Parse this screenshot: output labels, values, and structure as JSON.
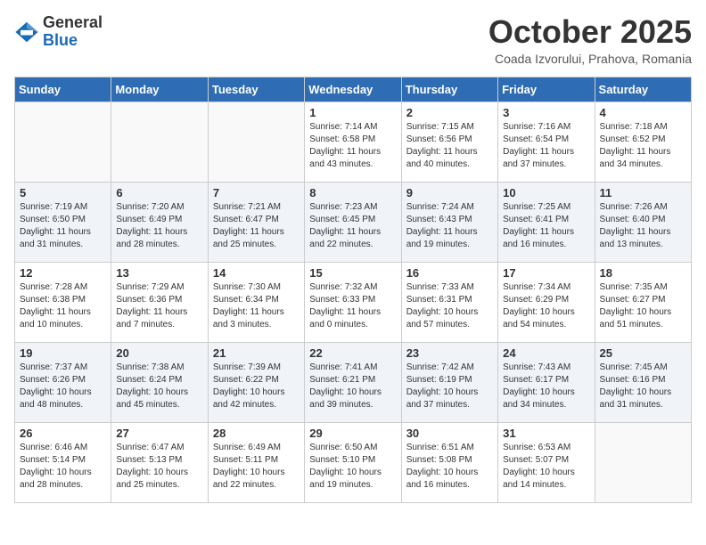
{
  "logo": {
    "general": "General",
    "blue": "Blue"
  },
  "title": "October 2025",
  "location": "Coada Izvorului, Prahova, Romania",
  "days_of_week": [
    "Sunday",
    "Monday",
    "Tuesday",
    "Wednesday",
    "Thursday",
    "Friday",
    "Saturday"
  ],
  "weeks": [
    [
      {
        "day": "",
        "info": ""
      },
      {
        "day": "",
        "info": ""
      },
      {
        "day": "",
        "info": ""
      },
      {
        "day": "1",
        "info": "Sunrise: 7:14 AM\nSunset: 6:58 PM\nDaylight: 11 hours and 43 minutes."
      },
      {
        "day": "2",
        "info": "Sunrise: 7:15 AM\nSunset: 6:56 PM\nDaylight: 11 hours and 40 minutes."
      },
      {
        "day": "3",
        "info": "Sunrise: 7:16 AM\nSunset: 6:54 PM\nDaylight: 11 hours and 37 minutes."
      },
      {
        "day": "4",
        "info": "Sunrise: 7:18 AM\nSunset: 6:52 PM\nDaylight: 11 hours and 34 minutes."
      }
    ],
    [
      {
        "day": "5",
        "info": "Sunrise: 7:19 AM\nSunset: 6:50 PM\nDaylight: 11 hours and 31 minutes."
      },
      {
        "day": "6",
        "info": "Sunrise: 7:20 AM\nSunset: 6:49 PM\nDaylight: 11 hours and 28 minutes."
      },
      {
        "day": "7",
        "info": "Sunrise: 7:21 AM\nSunset: 6:47 PM\nDaylight: 11 hours and 25 minutes."
      },
      {
        "day": "8",
        "info": "Sunrise: 7:23 AM\nSunset: 6:45 PM\nDaylight: 11 hours and 22 minutes."
      },
      {
        "day": "9",
        "info": "Sunrise: 7:24 AM\nSunset: 6:43 PM\nDaylight: 11 hours and 19 minutes."
      },
      {
        "day": "10",
        "info": "Sunrise: 7:25 AM\nSunset: 6:41 PM\nDaylight: 11 hours and 16 minutes."
      },
      {
        "day": "11",
        "info": "Sunrise: 7:26 AM\nSunset: 6:40 PM\nDaylight: 11 hours and 13 minutes."
      }
    ],
    [
      {
        "day": "12",
        "info": "Sunrise: 7:28 AM\nSunset: 6:38 PM\nDaylight: 11 hours and 10 minutes."
      },
      {
        "day": "13",
        "info": "Sunrise: 7:29 AM\nSunset: 6:36 PM\nDaylight: 11 hours and 7 minutes."
      },
      {
        "day": "14",
        "info": "Sunrise: 7:30 AM\nSunset: 6:34 PM\nDaylight: 11 hours and 3 minutes."
      },
      {
        "day": "15",
        "info": "Sunrise: 7:32 AM\nSunset: 6:33 PM\nDaylight: 11 hours and 0 minutes."
      },
      {
        "day": "16",
        "info": "Sunrise: 7:33 AM\nSunset: 6:31 PM\nDaylight: 10 hours and 57 minutes."
      },
      {
        "day": "17",
        "info": "Sunrise: 7:34 AM\nSunset: 6:29 PM\nDaylight: 10 hours and 54 minutes."
      },
      {
        "day": "18",
        "info": "Sunrise: 7:35 AM\nSunset: 6:27 PM\nDaylight: 10 hours and 51 minutes."
      }
    ],
    [
      {
        "day": "19",
        "info": "Sunrise: 7:37 AM\nSunset: 6:26 PM\nDaylight: 10 hours and 48 minutes."
      },
      {
        "day": "20",
        "info": "Sunrise: 7:38 AM\nSunset: 6:24 PM\nDaylight: 10 hours and 45 minutes."
      },
      {
        "day": "21",
        "info": "Sunrise: 7:39 AM\nSunset: 6:22 PM\nDaylight: 10 hours and 42 minutes."
      },
      {
        "day": "22",
        "info": "Sunrise: 7:41 AM\nSunset: 6:21 PM\nDaylight: 10 hours and 39 minutes."
      },
      {
        "day": "23",
        "info": "Sunrise: 7:42 AM\nSunset: 6:19 PM\nDaylight: 10 hours and 37 minutes."
      },
      {
        "day": "24",
        "info": "Sunrise: 7:43 AM\nSunset: 6:17 PM\nDaylight: 10 hours and 34 minutes."
      },
      {
        "day": "25",
        "info": "Sunrise: 7:45 AM\nSunset: 6:16 PM\nDaylight: 10 hours and 31 minutes."
      }
    ],
    [
      {
        "day": "26",
        "info": "Sunrise: 6:46 AM\nSunset: 5:14 PM\nDaylight: 10 hours and 28 minutes."
      },
      {
        "day": "27",
        "info": "Sunrise: 6:47 AM\nSunset: 5:13 PM\nDaylight: 10 hours and 25 minutes."
      },
      {
        "day": "28",
        "info": "Sunrise: 6:49 AM\nSunset: 5:11 PM\nDaylight: 10 hours and 22 minutes."
      },
      {
        "day": "29",
        "info": "Sunrise: 6:50 AM\nSunset: 5:10 PM\nDaylight: 10 hours and 19 minutes."
      },
      {
        "day": "30",
        "info": "Sunrise: 6:51 AM\nSunset: 5:08 PM\nDaylight: 10 hours and 16 minutes."
      },
      {
        "day": "31",
        "info": "Sunrise: 6:53 AM\nSunset: 5:07 PM\nDaylight: 10 hours and 14 minutes."
      },
      {
        "day": "",
        "info": ""
      }
    ]
  ]
}
